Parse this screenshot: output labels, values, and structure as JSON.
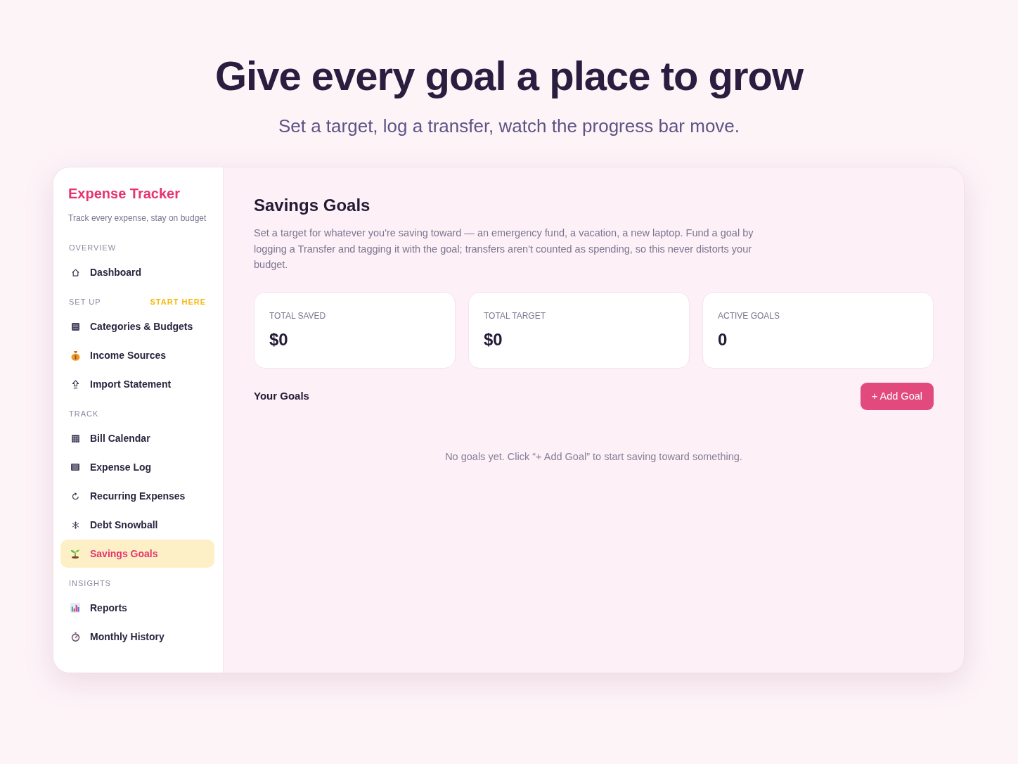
{
  "hero": {
    "title": "Give every goal a place to grow",
    "subtitle": "Set a target, log a transfer, watch the progress bar move."
  },
  "sidebar": {
    "brand": "Expense Tracker",
    "tagline": "Track every expense, stay on budget",
    "sections": [
      {
        "label": "OVERVIEW",
        "items": [
          {
            "label": "Dashboard",
            "selected": false
          }
        ]
      },
      {
        "label": "SET UP",
        "hint": "START HERE",
        "items": [
          {
            "label": "Categories & Budgets",
            "selected": false
          },
          {
            "label": "Income Sources",
            "selected": false
          },
          {
            "label": "Import Statement",
            "selected": false
          }
        ]
      },
      {
        "label": "TRACK",
        "items": [
          {
            "label": "Bill Calendar",
            "selected": false
          },
          {
            "label": "Expense Log",
            "selected": false
          },
          {
            "label": "Recurring Expenses",
            "selected": false
          },
          {
            "label": "Debt Snowball",
            "selected": false
          },
          {
            "label": "Savings Goals",
            "selected": true
          }
        ]
      },
      {
        "label": "INSIGHTS",
        "items": [
          {
            "label": "Reports",
            "selected": false
          },
          {
            "label": "Monthly History",
            "selected": false
          }
        ]
      }
    ]
  },
  "main": {
    "title": "Savings Goals",
    "description": "Set a target for whatever you're saving toward — an emergency fund, a vacation, a new laptop. Fund a goal by logging a Transfer and tagging it with the goal; transfers aren't counted as spending, so this never distorts your budget.",
    "stats": [
      {
        "label": "TOTAL SAVED",
        "value": "$0"
      },
      {
        "label": "TOTAL TARGET",
        "value": "$0"
      },
      {
        "label": "ACTIVE GOALS",
        "value": "0"
      }
    ],
    "goals": {
      "heading": "Your Goals",
      "add_button": "+ Add Goal",
      "empty_message": "No goals yet. Click “+ Add Goal” to start saving toward something."
    }
  }
}
